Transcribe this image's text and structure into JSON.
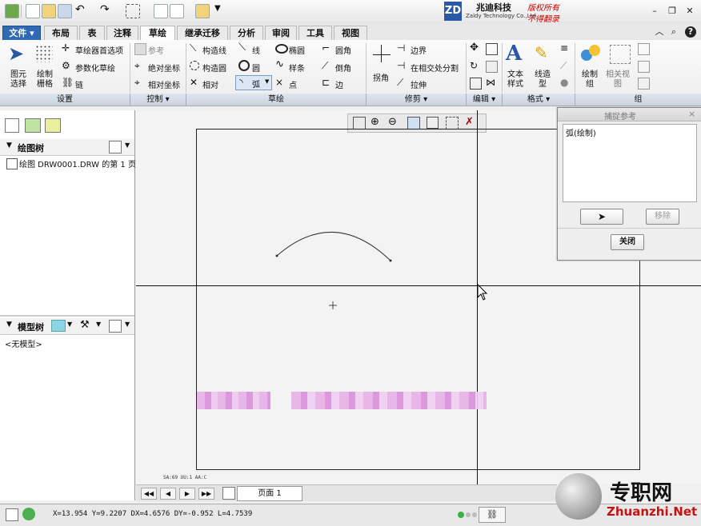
{
  "brand": {
    "logo": "ZD",
    "name_cn": "兆迪科技",
    "name_en": "Zaldy Technology Co.,Ltd.",
    "rights1": "版权所有",
    "rights2": "不得翻录"
  },
  "tabs": [
    {
      "label": "文件 ▾"
    },
    {
      "label": "布局"
    },
    {
      "label": "表"
    },
    {
      "label": "注释"
    },
    {
      "label": "草绘",
      "active": true
    },
    {
      "label": "继承迁移"
    },
    {
      "label": "分析"
    },
    {
      "label": "审阅"
    },
    {
      "label": "工具"
    },
    {
      "label": "视图"
    }
  ],
  "ribbon": {
    "setup": {
      "select": "图元\n选择",
      "draw_grid": "绘制\n栅格",
      "prefs": "草绘器首选项",
      "param_sketch": "参数化草绘",
      "chain": "链",
      "group": "设置"
    },
    "control": {
      "ref": "参考",
      "abs_coord": "绝对坐标",
      "rel_coord": "相对坐标",
      "group": "控制 ▾"
    },
    "sketch": {
      "constr_line": "构造线",
      "constr_circle": "构造圆",
      "relative": "相对",
      "line": "线",
      "circle": "圆",
      "arc": "弧",
      "ellipse": "椭圆",
      "spline": "样条",
      "point": "点",
      "fillet": "圆角",
      "chamfer": "倒角",
      "edge": "边",
      "group": "草绘"
    },
    "trim": {
      "corner": "拐角",
      "boundary": "边界",
      "split": "在相交处分割",
      "stretch": "拉伸",
      "group": "修剪 ▾"
    },
    "edit": {
      "group": "编辑 ▾"
    },
    "format": {
      "text_style": "文本\n样式",
      "line_style": "线造\n型",
      "group": "格式 ▾"
    },
    "groupgrp": {
      "draw_group": "绘制\n组",
      "related_view": "相关视\n图",
      "group": "组"
    }
  },
  "left": {
    "draw_tree_title": "绘图树",
    "draw_tree_item": "绘图 DRW0001.DRW 的第 1 页",
    "model_tree_title": "模型树",
    "model_tree_item": "<无模型>"
  },
  "dialog": {
    "title": "捕捉参考",
    "list_item": "弧(绘制)",
    "remove": "移除",
    "close": "关闭"
  },
  "canvas": {
    "small_text": "SA:69  UU:1  AA:C",
    "page_tab": "页面 1"
  },
  "status": {
    "coords": "X=13.954 Y=9.2207 DX=4.6576 DY=-0.952 L=4.7539"
  },
  "watermark": {
    "cn": "专职网",
    "url": "Zhuanzhi.Net"
  },
  "colors": {
    "file_tab": "#2f6bb3",
    "blur_patch": "#e2a7e2",
    "watermark_red": "#c41313"
  }
}
